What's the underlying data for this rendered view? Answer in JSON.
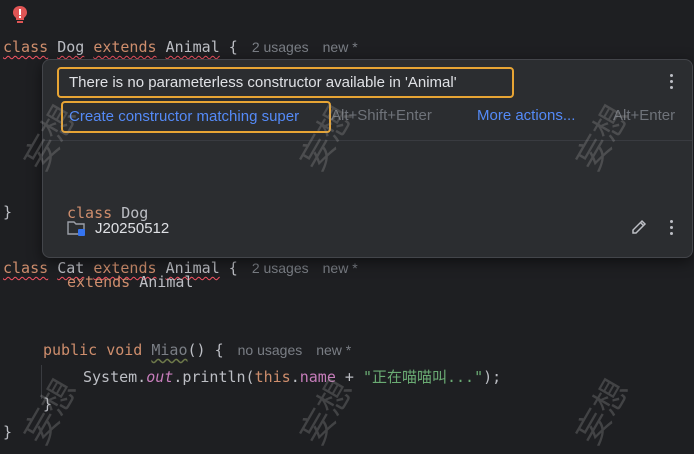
{
  "editor": {
    "line1": {
      "kw_class": "class",
      "name": "Dog",
      "kw_extends": "extends",
      "parent": "Animal",
      "brace": "{",
      "usages": "2 usages",
      "author": "new *"
    },
    "line_close1": "}",
    "line2": {
      "kw_class": "class",
      "name": "Cat",
      "kw_extends": "extends",
      "parent": "Animal",
      "brace": "{",
      "usages": "2 usages",
      "author": "new *"
    },
    "method": {
      "kw_public": "public",
      "kw_void": "void",
      "name": "Miao",
      "parens": "()",
      "brace": "{",
      "usages": "no usages",
      "author": "new *"
    },
    "body": {
      "obj": "System.",
      "field": "out",
      "call": ".println(",
      "kw_this": "this",
      "dot": ".",
      "member": "name",
      "plus": " + ",
      "string": "\"正在喵喵叫...\"",
      "end": ");"
    },
    "close_method": "}",
    "close_class": "}"
  },
  "popup": {
    "message": "There is no parameterless constructor available in 'Animal'",
    "fix_label": "Create constructor matching super",
    "fix_shortcut": "Alt+Shift+Enter",
    "more_actions": "More actions...",
    "more_shortcut": "Alt+Enter",
    "decl_line1_kw": "class",
    "decl_line1_name": "Dog",
    "decl_line2_kw": "extends",
    "decl_line2_name": "Animal",
    "module": "J20250512"
  },
  "watermark": "妄想",
  "colors": {
    "background": "#1e1f22",
    "keyword": "#cf8e6d",
    "link": "#548af7",
    "highlight": "#e7a434",
    "error": "#f75464",
    "string": "#6aab73",
    "field": "#c77dbb"
  }
}
